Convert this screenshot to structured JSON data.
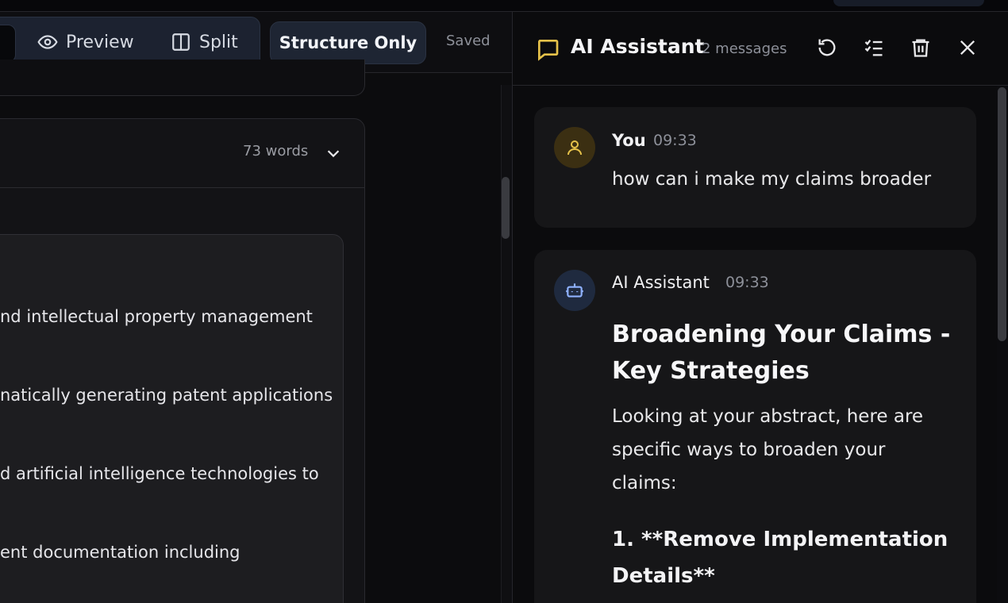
{
  "toolbar": {
    "preview_label": "Preview",
    "split_label": "Split",
    "structure_label": "Structure Only",
    "saved_label": "Saved"
  },
  "section": {
    "word_count": "73 words",
    "abstract_lines": [
      "nd intellectual property management",
      "natically generating patent applications",
      "d artificial intelligence technologies to",
      "ent documentation including"
    ]
  },
  "assistant": {
    "title": "AI Assistant",
    "message_count": "2 messages",
    "messages": [
      {
        "author": "You",
        "time": "09:33",
        "text": "how can i make my claims broader"
      },
      {
        "author": "AI Assistant",
        "time": "09:33",
        "heading": [
          "Broadening Your Claims -",
          "Key Strategies"
        ],
        "paragraph": [
          "Looking at your abstract, here are",
          "specific ways to broaden your",
          "claims:"
        ],
        "subheading": [
          "1. **Remove Implementation",
          "Details**"
        ]
      }
    ]
  },
  "colors": {
    "accent_yellow": "#e6c24a",
    "background": "#0b0b0d",
    "bubble": "#161618",
    "toolbar_active": "#1e2533"
  }
}
